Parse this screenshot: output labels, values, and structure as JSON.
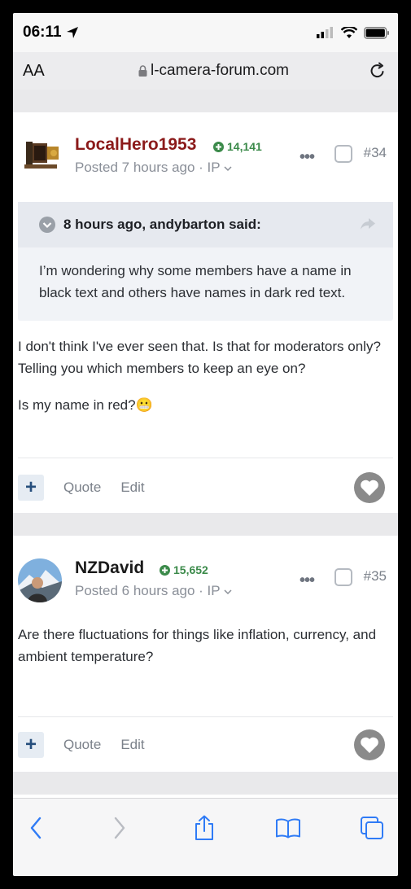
{
  "status": {
    "time": "06:11"
  },
  "browser": {
    "text_size_label": "AA",
    "url": "l-camera-forum.com"
  },
  "posts": [
    {
      "username": "LocalHero1953",
      "username_color": "#8b1a1a",
      "reputation": "14,141",
      "posted": "Posted 7 hours ago · IP ",
      "number": "#34",
      "quote": {
        "header": "8 hours ago, andybarton said:",
        "text": "I’m wondering why some members have a name in black text and others have names in dark red text."
      },
      "paragraphs": [
        "I don't think I've ever seen that. Is that for moderators only? Telling you which members to keep an eye on?",
        "Is my name in red?😬"
      ],
      "actions": {
        "quote": "Quote",
        "edit": "Edit"
      }
    },
    {
      "username": "NZDavid",
      "username_color": "#1a1a1a",
      "reputation": "15,652",
      "posted": "Posted 6 hours ago · IP ",
      "number": "#35",
      "paragraphs": [
        "Are there fluctuations for things like inflation, currency, and ambient temperature?"
      ],
      "actions": {
        "quote": "Quote",
        "edit": "Edit"
      }
    }
  ],
  "colors": {
    "rep_green": "#3b8a4a",
    "ios_blue": "#2f7bf6",
    "button_blue": "#264e7c"
  },
  "icons": [
    "location-arrow-icon",
    "signal-icon",
    "wifi-icon",
    "battery-icon",
    "lock-icon",
    "reload-icon",
    "back-icon",
    "forward-icon",
    "share-icon",
    "bookmarks-icon",
    "tabs-icon",
    "heart-icon",
    "plus-icon",
    "chevron-down-icon",
    "ellipsis-icon"
  ]
}
